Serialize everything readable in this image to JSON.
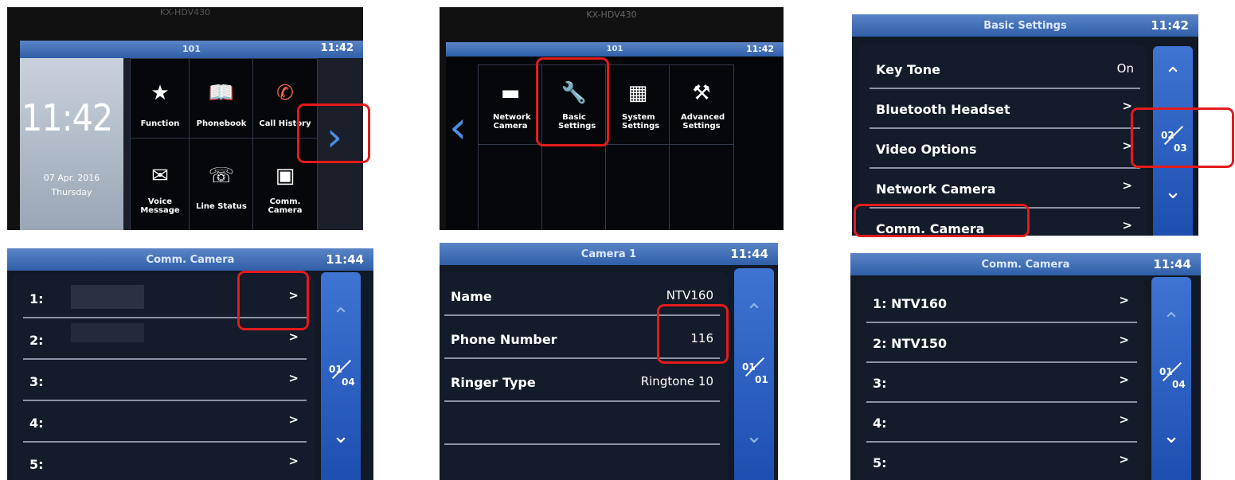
{
  "p1": {
    "ext": "101",
    "clock": "11:42",
    "big_time": "11:42",
    "date": "07 Apr. 2016",
    "day": "Thursday",
    "model": "KX-HDV430",
    "tiles": [
      {
        "label": "Function",
        "icon": "★"
      },
      {
        "label": "Phonebook",
        "icon": "📖"
      },
      {
        "label": "Call History",
        "icon": "✆"
      },
      {
        "label": "Voice Message",
        "icon": "✉"
      },
      {
        "label": "Line Status",
        "icon": "☏"
      },
      {
        "label": "Comm. Camera",
        "icon": "▣"
      }
    ],
    "next_arrow": "›"
  },
  "p2": {
    "ext": "101",
    "clock": "11:42",
    "model": "KX-HDV430",
    "tiles": [
      {
        "label": "Network Camera",
        "icon": "▬"
      },
      {
        "label": "Basic Settings",
        "icon": "🔧"
      },
      {
        "label": "System Settings",
        "icon": "▦"
      },
      {
        "label": "Advanced Settings",
        "icon": "⚒"
      }
    ],
    "prev_arrow": "‹"
  },
  "p3": {
    "title": "Basic Settings",
    "clock": "11:42",
    "rows": [
      {
        "label": "Key Tone",
        "value": "On"
      },
      {
        "label": "Bluetooth Headset",
        "value": ">"
      },
      {
        "label": "Video Options",
        "value": ">"
      },
      {
        "label": "Network Camera",
        "value": ">"
      },
      {
        "label": "Comm. Camera",
        "value": ">"
      }
    ],
    "page_current": "02",
    "page_total": "03"
  },
  "p4": {
    "title": "Comm. Camera",
    "clock": "11:44",
    "rows": [
      {
        "label": "1:",
        "value": ">"
      },
      {
        "label": "2:",
        "value": ">"
      },
      {
        "label": "3:",
        "value": ">"
      },
      {
        "label": "4:",
        "value": ">"
      },
      {
        "label": "5:",
        "value": ">"
      }
    ],
    "page_current": "01",
    "page_total": "04"
  },
  "p5": {
    "title": "Camera 1",
    "clock": "11:44",
    "rows": [
      {
        "label": "Name",
        "value": "NTV160"
      },
      {
        "label": "Phone Number",
        "value": "116"
      },
      {
        "label": "Ringer Type",
        "value": "Ringtone 10"
      }
    ],
    "page_current": "01",
    "page_total": "01"
  },
  "p6": {
    "title": "Comm. Camera",
    "clock": "11:44",
    "rows": [
      {
        "label": "1: NTV160",
        "value": ">"
      },
      {
        "label": "2: NTV150",
        "value": ">"
      },
      {
        "label": "3:",
        "value": ">"
      },
      {
        "label": "4:",
        "value": ">"
      },
      {
        "label": "5:",
        "value": ">"
      }
    ],
    "page_current": "01",
    "page_total": "04"
  },
  "icons": {
    "up": "⌃",
    "down": "⌄"
  }
}
